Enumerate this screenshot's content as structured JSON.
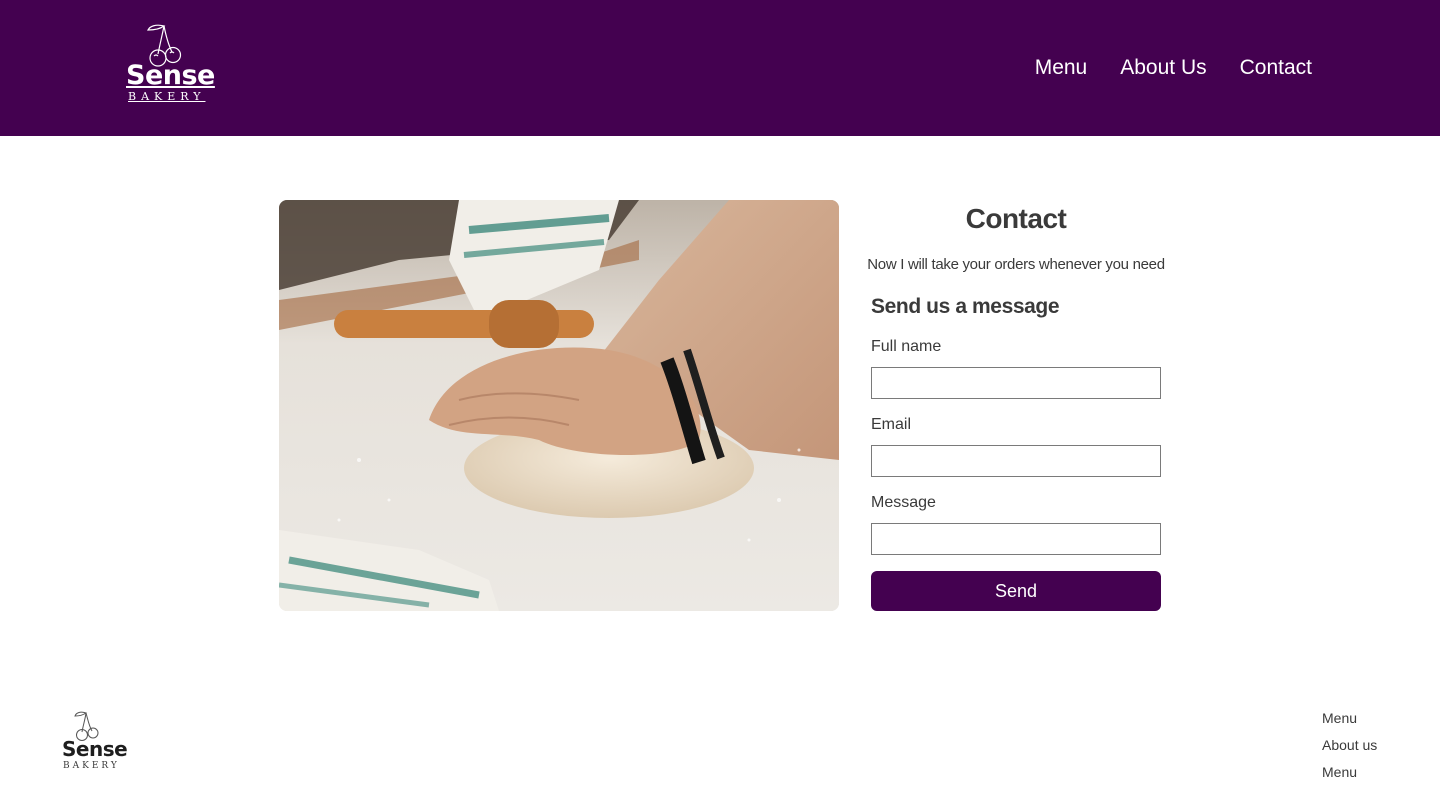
{
  "brand": {
    "name": "Sense",
    "tagline": "BAKERY",
    "primary_color": "#440150"
  },
  "nav": {
    "items": [
      "Menu",
      "About Us",
      "Contact"
    ]
  },
  "hero_image": {
    "icon": "dough-kneading-photo"
  },
  "contact": {
    "title": "Contact",
    "subtitle": "Now I will take your orders whenever you need",
    "form_title": "Send us a message",
    "fields": [
      {
        "label": "Full name",
        "value": ""
      },
      {
        "label": "Email",
        "value": ""
      },
      {
        "label": "Message",
        "value": ""
      }
    ],
    "send_label": "Send"
  },
  "footer": {
    "brand_name": "Sense",
    "brand_tagline": "BAKERY",
    "links": [
      "Menu",
      "About us",
      "Menu"
    ]
  }
}
